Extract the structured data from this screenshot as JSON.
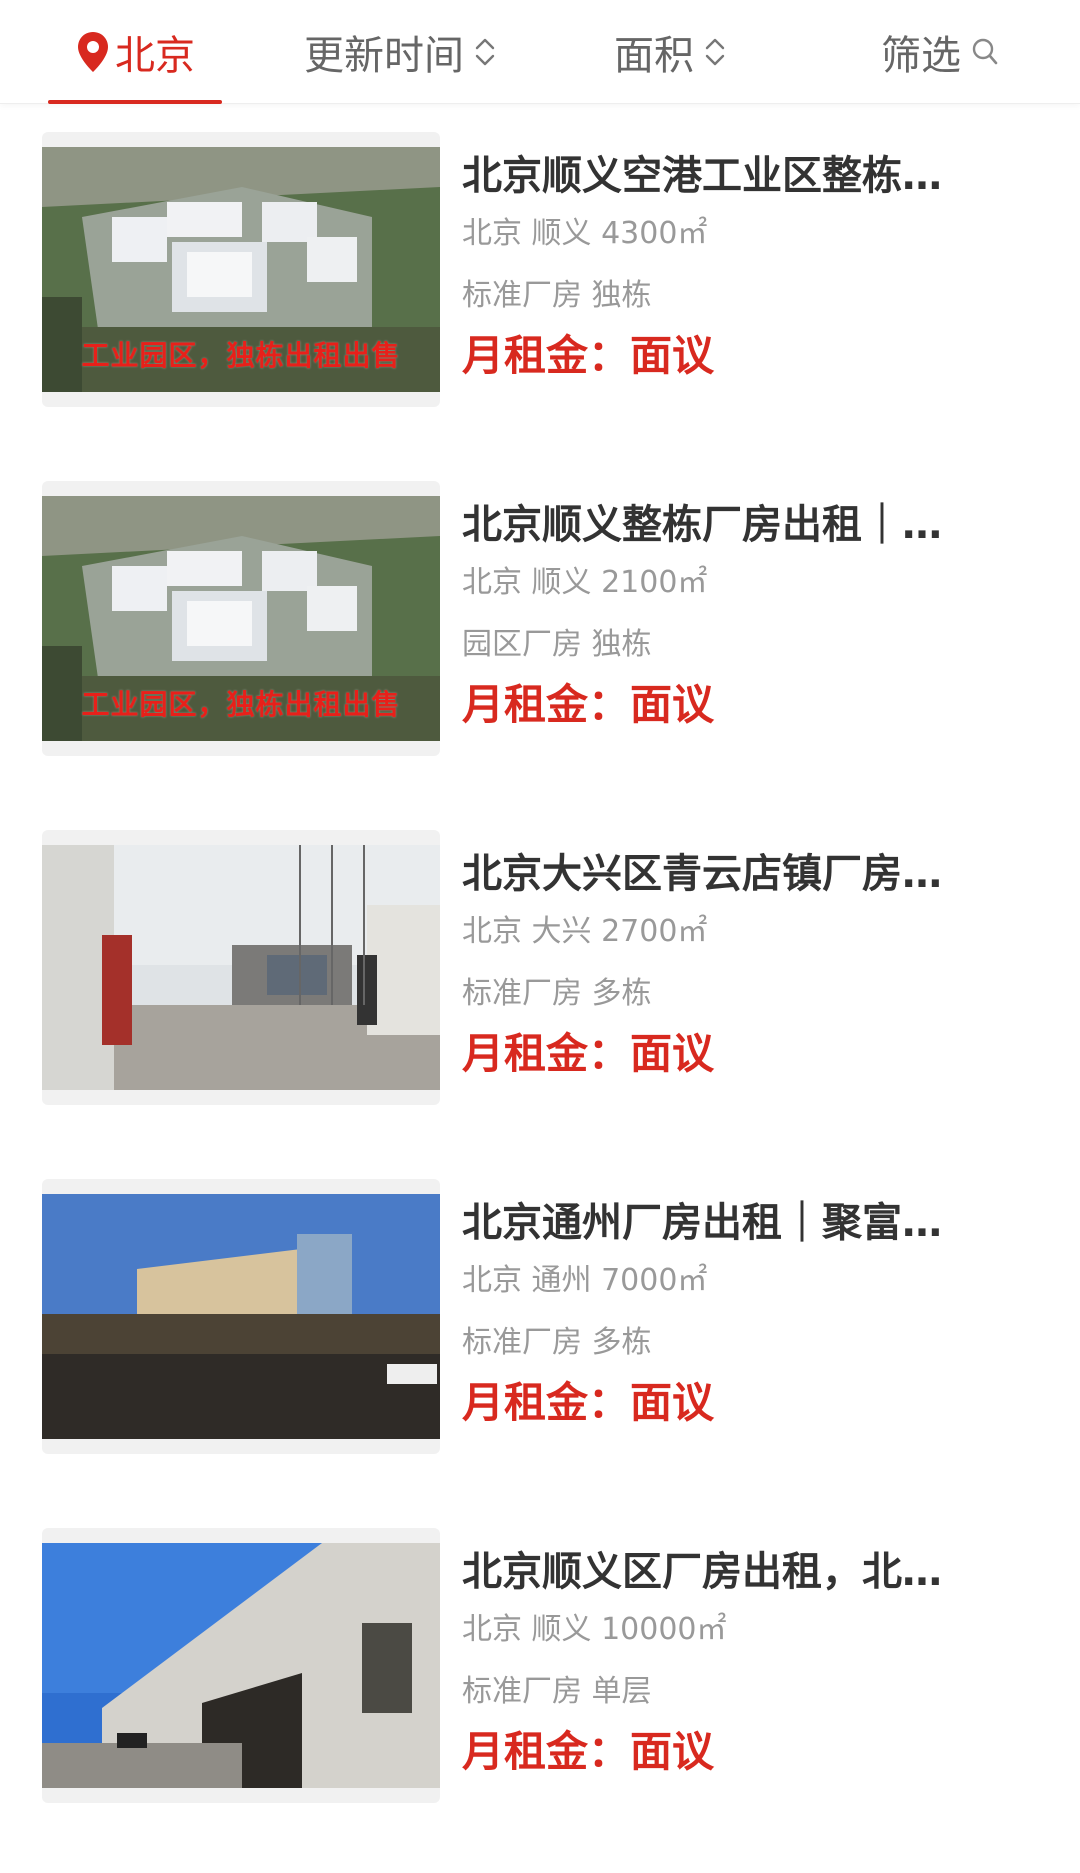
{
  "filter_bar": {
    "city_label": "北京",
    "update_label": "更新时间",
    "area_label": "面积",
    "screen_label": "筛选",
    "accent_color": "#d8291f"
  },
  "listings": [
    {
      "title": "北京顺义空港工业区整栋…",
      "location": "北京 顺义 4300㎡",
      "type": "标准厂房 独栋",
      "price": "月租金：面议",
      "image_caption": "工业园区，独栋出租出售"
    },
    {
      "title": "北京顺义整栋厂房出租｜…",
      "location": "北京 顺义 2100㎡",
      "type": "园区厂房 独栋",
      "price": "月租金：面议",
      "image_caption": "工业园区，独栋出租出售"
    },
    {
      "title": "北京大兴区青云店镇厂房…",
      "location": "北京 大兴 2700㎡",
      "type": "标准厂房 多栋",
      "price": "月租金：面议"
    },
    {
      "title": "北京通州厂房出租｜聚富…",
      "location": "北京 通州 7000㎡",
      "type": "标准厂房 多栋",
      "price": "月租金：面议"
    },
    {
      "title": "北京顺义区厂房出租，北…",
      "location": "北京 顺义 10000㎡",
      "type": "标准厂房 单层",
      "price": "月租金：面议"
    }
  ]
}
